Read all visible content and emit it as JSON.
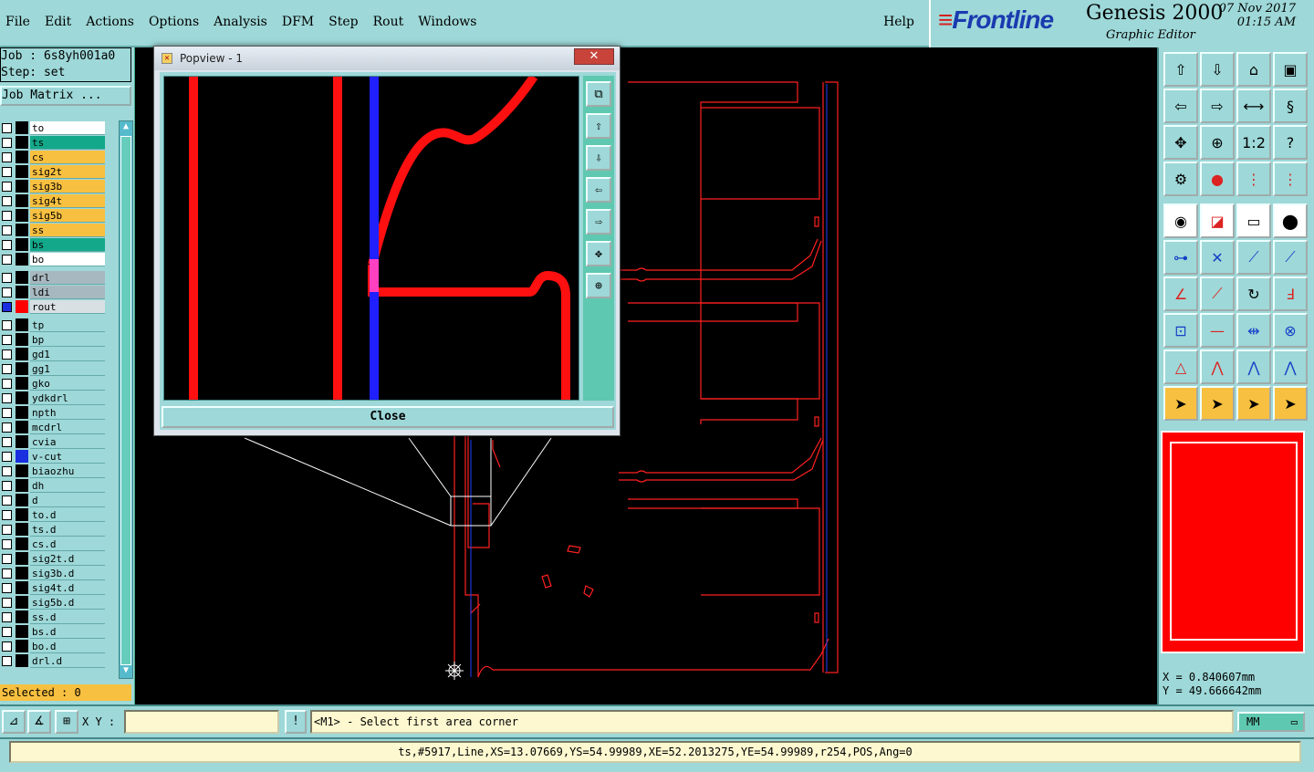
{
  "menu": {
    "items": [
      "File",
      "Edit",
      "Actions",
      "Options",
      "Analysis",
      "DFM",
      "Step",
      "Rout",
      "Windows"
    ],
    "help": "Help"
  },
  "brand": {
    "logo": "Frontline",
    "product": "Genesis 2000",
    "subtitle": "Graphic Editor",
    "date": "07 Nov 2017",
    "time": "01:15 AM"
  },
  "job": {
    "job_line": "Job : 6s8yh001a0",
    "step_line": "Step: set",
    "matrix_button": "Job Matrix ..."
  },
  "layers": [
    {
      "name": "to",
      "bg": "#ffffff",
      "swatch": ""
    },
    {
      "name": "ts",
      "bg": "#13a88a",
      "swatch": ""
    },
    {
      "name": "cs",
      "bg": "#f8c040",
      "swatch": ""
    },
    {
      "name": "sig2t",
      "bg": "#f8c040",
      "swatch": ""
    },
    {
      "name": "sig3b",
      "bg": "#f8c040",
      "swatch": ""
    },
    {
      "name": "sig4t",
      "bg": "#f8c040",
      "swatch": ""
    },
    {
      "name": "sig5b",
      "bg": "#f8c040",
      "swatch": ""
    },
    {
      "name": "ss",
      "bg": "#f8c040",
      "swatch": ""
    },
    {
      "name": "bs",
      "bg": "#13a88a",
      "swatch": ""
    },
    {
      "name": "bo",
      "bg": "#ffffff",
      "swatch": ""
    },
    {
      "name": "drl",
      "bg": "#a8b8c0",
      "swatch": "",
      "gap": true
    },
    {
      "name": "ldi",
      "bg": "#a8b8c0",
      "swatch": ""
    },
    {
      "name": "rout",
      "bg": "#d8e0e4",
      "swatch": "#ff0000",
      "active": true
    },
    {
      "name": "tp",
      "bg": "#9ed8d8",
      "swatch": "",
      "gap": true
    },
    {
      "name": "bp",
      "bg": "#9ed8d8",
      "swatch": ""
    },
    {
      "name": "gd1",
      "bg": "#9ed8d8",
      "swatch": ""
    },
    {
      "name": "gg1",
      "bg": "#9ed8d8",
      "swatch": ""
    },
    {
      "name": "gko",
      "bg": "#9ed8d8",
      "swatch": ""
    },
    {
      "name": "ydkdrl",
      "bg": "#9ed8d8",
      "swatch": ""
    },
    {
      "name": "npth",
      "bg": "#9ed8d8",
      "swatch": ""
    },
    {
      "name": "mcdrl",
      "bg": "#9ed8d8",
      "swatch": ""
    },
    {
      "name": "cvia",
      "bg": "#9ed8d8",
      "swatch": ""
    },
    {
      "name": "v-cut",
      "bg": "#9ed8d8",
      "swatch": "#1a2fe0"
    },
    {
      "name": "biaozhu",
      "bg": "#9ed8d8",
      "swatch": ""
    },
    {
      "name": "dh",
      "bg": "#9ed8d8",
      "swatch": ""
    },
    {
      "name": "d",
      "bg": "#9ed8d8",
      "swatch": ""
    },
    {
      "name": "to.d",
      "bg": "#9ed8d8",
      "swatch": ""
    },
    {
      "name": "ts.d",
      "bg": "#9ed8d8",
      "swatch": ""
    },
    {
      "name": "cs.d",
      "bg": "#9ed8d8",
      "swatch": ""
    },
    {
      "name": "sig2t.d",
      "bg": "#9ed8d8",
      "swatch": ""
    },
    {
      "name": "sig3b.d",
      "bg": "#9ed8d8",
      "swatch": ""
    },
    {
      "name": "sig4t.d",
      "bg": "#9ed8d8",
      "swatch": ""
    },
    {
      "name": "sig5b.d",
      "bg": "#9ed8d8",
      "swatch": ""
    },
    {
      "name": "ss.d",
      "bg": "#9ed8d8",
      "swatch": ""
    },
    {
      "name": "bs.d",
      "bg": "#9ed8d8",
      "swatch": ""
    },
    {
      "name": "bo.d",
      "bg": "#9ed8d8",
      "swatch": ""
    },
    {
      "name": "drl.d",
      "bg": "#9ed8d8",
      "swatch": ""
    }
  ],
  "selected_text": "Selected : 0",
  "popview": {
    "title": "Popview - 1",
    "close_x": "✕",
    "close_button": "Close",
    "tool_icons": [
      "zoom-window-icon",
      "pan-up-icon",
      "pan-down-icon",
      "pan-left-icon",
      "pan-right-icon",
      "zoom-home-icon",
      "zoom-fit-icon"
    ]
  },
  "coords": {
    "x": "X = 0.840607mm",
    "y": "Y = 49.666642mm"
  },
  "bottom": {
    "xy_label": "X Y :",
    "xy_value": "",
    "warn": "!",
    "prompt": "<M1> - Select first area corner",
    "units": "MM"
  },
  "status": "ts,#5917,Line,XS=13.07669,YS=54.99989,XE=52.2013275,YE=54.99989,r254,POS,Ang=0",
  "colors": {
    "panel": "#9ed8d8",
    "rout": "#ff0000",
    "vcut": "#1a2fe0",
    "input_bg": "#fdf8d0"
  }
}
